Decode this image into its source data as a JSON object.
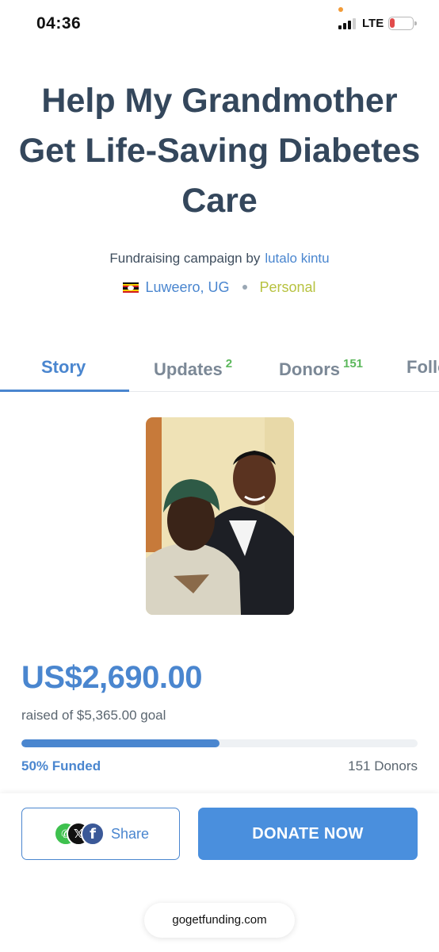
{
  "status_bar": {
    "time": "04:36",
    "network": "LTE",
    "battery": "7"
  },
  "campaign": {
    "title": "Help My Grandmother Get Life-Saving Diabetes Care",
    "byline_prefix": "Fundraising campaign by",
    "creator": "lutalo kintu",
    "location": "Luweero, UG",
    "category": "Personal"
  },
  "tabs": [
    {
      "label": "Story",
      "badge": ""
    },
    {
      "label": "Updates",
      "badge": "2"
    },
    {
      "label": "Donors",
      "badge": "151"
    },
    {
      "label": "Follo",
      "badge": ""
    }
  ],
  "funding": {
    "raised": "US$2,690.00",
    "goal_text": "raised of $5,365.00 goal",
    "progress_fraction": 0.5,
    "funded_text": "50% Funded",
    "donors_text": "151 Donors"
  },
  "actions": {
    "share_label": "Share",
    "donate_label": "DONATE NOW",
    "share_icons": [
      "whatsapp-icon",
      "x-icon",
      "facebook-icon"
    ]
  },
  "browser": {
    "url": "gogetfunding.com"
  },
  "colors": {
    "accent": "#4a86cf",
    "title": "#34475c",
    "category": "#b7c240",
    "badge": "#5cb85c"
  }
}
